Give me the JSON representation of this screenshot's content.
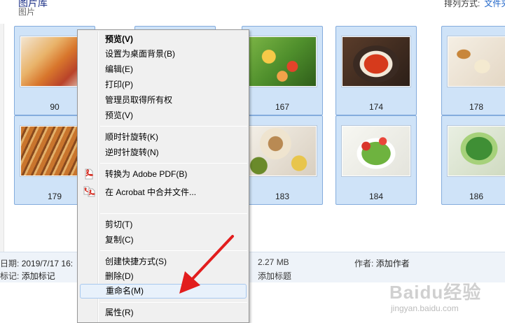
{
  "header": {
    "library_title": "图片库",
    "subtitle": "图片",
    "sort_label": "排列方式:",
    "sort_value": "文件夹"
  },
  "thumbnails": [
    {
      "label": "90"
    },
    {
      "label": ""
    },
    {
      "label": "167"
    },
    {
      "label": "174"
    },
    {
      "label": "178"
    },
    {
      "label": "179"
    },
    {
      "label": ""
    },
    {
      "label": "183"
    },
    {
      "label": "184"
    },
    {
      "label": "186"
    }
  ],
  "details": {
    "date_label": "日期:",
    "date_value": "2019/7/17 16:",
    "tags_label": "标记:",
    "tags_value": "添加标记",
    "size_value": "2.27 MB",
    "title_value": "添加标题",
    "author_label": "作者:",
    "author_value": "添加作者"
  },
  "context_menu": {
    "items": [
      {
        "label": "预览(V)",
        "bold": true
      },
      {
        "label": "设置为桌面背景(B)"
      },
      {
        "label": "编辑(E)"
      },
      {
        "label": "打印(P)"
      },
      {
        "label": "管理员取得所有权"
      },
      {
        "label": "预览(V)"
      },
      {
        "label": "顺时针旋转(K)"
      },
      {
        "label": "逆时针旋转(N)"
      },
      {
        "label": "转换为 Adobe PDF(B)",
        "icon": "adobe-pdf-icon"
      },
      {
        "label": "在 Acrobat 中合并文件...",
        "icon": "acrobat-combine-icon"
      },
      {
        "label": "剪切(T)"
      },
      {
        "label": "复制(C)"
      },
      {
        "label": "创建快捷方式(S)"
      },
      {
        "label": "删除(D)"
      },
      {
        "label": "重命名(M)",
        "highlighted": true
      },
      {
        "label": "属性(R)"
      }
    ]
  },
  "annotation": {
    "arrow_color": "#e21d1d"
  },
  "watermark": {
    "brand": "Baidu经验",
    "url": "jingyan.baidu.com"
  },
  "colors": {
    "selection_bg": "#cfe3f8",
    "selection_border": "#84acdd",
    "menu_bg": "#f0f0f0",
    "menu_highlight": "#e8f1fb"
  }
}
